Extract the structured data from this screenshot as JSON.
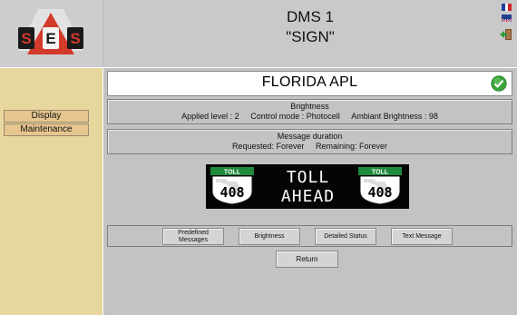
{
  "brand": {
    "logo_text": "SES"
  },
  "header": {
    "title": "DMS 1",
    "subtitle": "\"SIGN\""
  },
  "sidebar": {
    "items": [
      {
        "label": "Display"
      },
      {
        "label": "Maintenance"
      }
    ]
  },
  "sign": {
    "name": "FLORIDA APL",
    "status_icon": "check-circle-icon",
    "status_color": "#3aa43a"
  },
  "brightness": {
    "title": "Brightness",
    "applied": "Applied level : 2",
    "control": "Control mode : Photocell",
    "ambient": "Ambiant Brightness : 98"
  },
  "duration": {
    "title": "Message duration",
    "requested": "Requested: Forever",
    "remaining": "Remaining: Forever"
  },
  "display": {
    "line1": "TOLL",
    "line2": "AHEAD",
    "shield_label": "TOLL",
    "shield_number": "408",
    "shield_color": "#1f8a3a"
  },
  "actions": {
    "predefined_line1": "Predefined",
    "predefined_line2": "Messages",
    "brightness": "Brightness",
    "detailed_status": "Detailed Status",
    "text_message": "Text Message",
    "return": "Return"
  }
}
